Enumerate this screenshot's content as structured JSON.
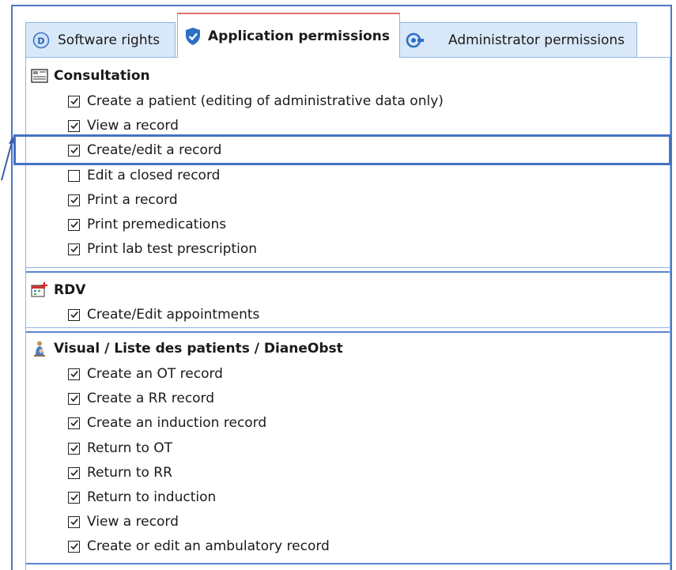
{
  "tabs": [
    {
      "label": "Software rights",
      "active": false,
      "icon": "d-circle-icon"
    },
    {
      "label": "Application permissions",
      "active": true,
      "icon": "shield-check-icon"
    },
    {
      "label": "Administrator permissions",
      "active": false,
      "icon": "admin-gear-icon"
    }
  ],
  "groups": {
    "consultation": {
      "title": "Consultation",
      "icon": "card-icon",
      "items": [
        {
          "label": "Create a patient (editing of administrative data only)",
          "checked": true
        },
        {
          "label": "View a record",
          "checked": true
        },
        {
          "label": "Create/edit a record",
          "checked": true
        },
        {
          "label": "Edit a closed record",
          "checked": false
        },
        {
          "label": "Print a record",
          "checked": true
        },
        {
          "label": "Print premedications",
          "checked": true
        },
        {
          "label": "Print lab test prescription",
          "checked": true
        }
      ]
    },
    "rdv": {
      "title": "RDV",
      "icon": "calendar-icon",
      "items": [
        {
          "label": "Create/Edit appointments",
          "checked": true
        }
      ]
    },
    "visual": {
      "title": "Visual / Liste des patients / DianeObst",
      "icon": "mother-child-icon",
      "items": [
        {
          "label": "Create an OT record",
          "checked": true
        },
        {
          "label": "Create a RR record",
          "checked": true
        },
        {
          "label": "Create an induction record",
          "checked": true
        },
        {
          "label": "Return to OT",
          "checked": true
        },
        {
          "label": "Return to RR",
          "checked": true
        },
        {
          "label": "Return to induction",
          "checked": true
        },
        {
          "label": "View a record",
          "checked": true
        },
        {
          "label": "Create or edit an ambulatory record",
          "checked": true
        }
      ]
    }
  },
  "colors": {
    "accent": "#4472c4",
    "tab_bg": "#d9e8f8",
    "active_tab_top": "#e07070"
  }
}
